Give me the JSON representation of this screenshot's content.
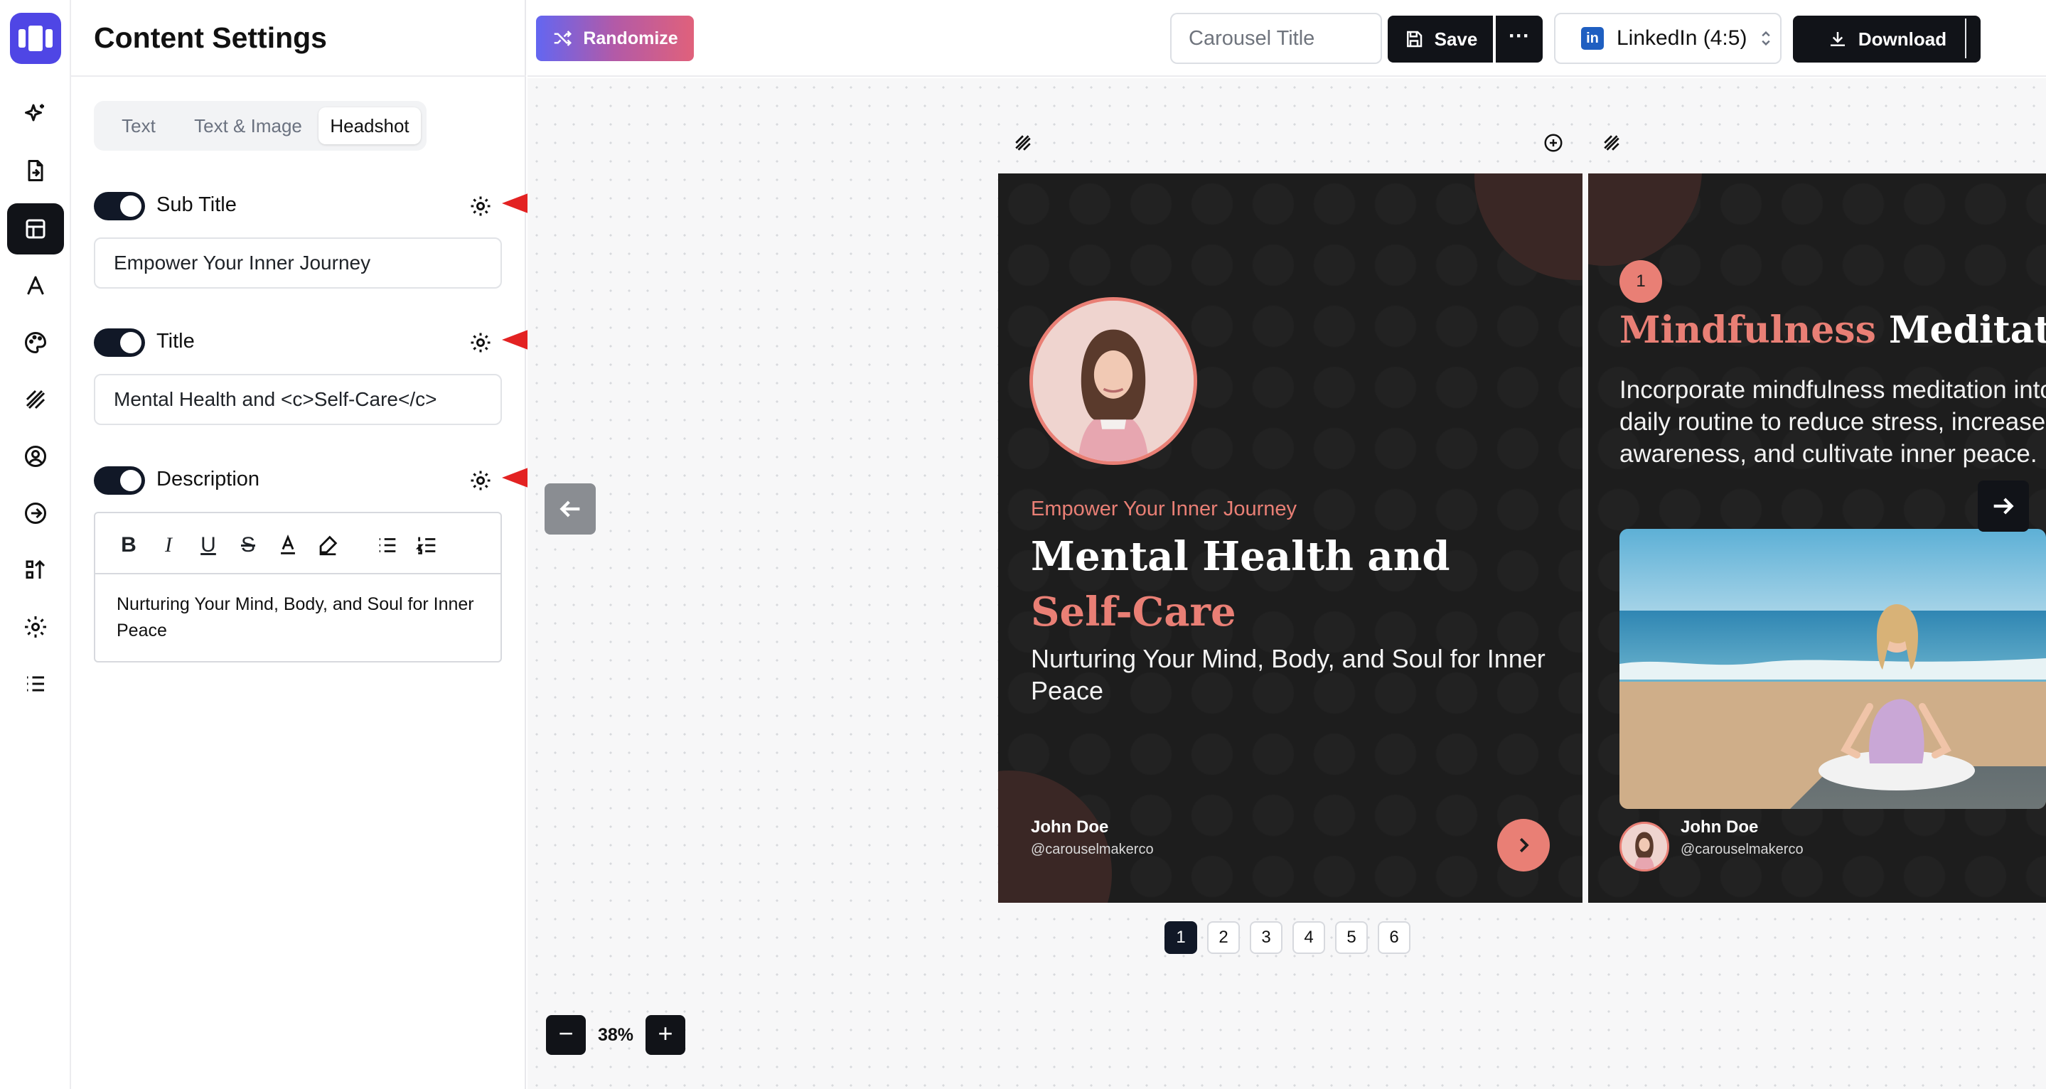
{
  "rail": {
    "items": [
      {
        "icon": "sparkles-icon"
      },
      {
        "icon": "file-import-icon"
      },
      {
        "icon": "layout-icon",
        "active": true
      },
      {
        "icon": "typography-icon"
      },
      {
        "icon": "palette-icon"
      },
      {
        "icon": "pattern-icon"
      },
      {
        "icon": "user-circle-icon"
      },
      {
        "icon": "arrow-circle-right-icon"
      },
      {
        "icon": "sort-icon"
      },
      {
        "icon": "settings-icon"
      },
      {
        "icon": "list-icon"
      }
    ]
  },
  "panel": {
    "title": "Content Settings",
    "tabs": [
      {
        "label": "Text"
      },
      {
        "label": "Text & Image"
      },
      {
        "label": "Headshot",
        "active": true
      }
    ],
    "subtitle_field": {
      "label": "Sub Title",
      "enabled": true,
      "value": "Empower Your Inner Journey"
    },
    "title_field": {
      "label": "Title",
      "enabled": true,
      "value": "Mental Health and <c>Self-Care</c>"
    },
    "description_field": {
      "label": "Description",
      "enabled": true,
      "toolbar": {
        "bold": "B",
        "italic": "I",
        "underline": "U",
        "strike": "S"
      },
      "value": "Nurturing Your Mind, Body, and Soul for Inner Peace"
    }
  },
  "topbar": {
    "randomize_label": "Randomize",
    "carousel_title_placeholder": "Carousel Title",
    "save_label": "Save",
    "more_label": "···",
    "platform_label": "LinkedIn (4:5)",
    "platform_badge": "in",
    "download_label": "Download"
  },
  "slides": [
    {
      "subtitle": "Empower Your Inner Journey",
      "title_part1": "Mental Health and ",
      "title_highlight": "Self-Care",
      "description": "Nurturing Your Mind, Body, and Soul for Inner Peace",
      "author_name": "John Doe",
      "author_handle": "@carouselmakerco"
    },
    {
      "number": "1",
      "title_highlight": "Mindfulness",
      "title_rest": " Meditation",
      "description_lines": [
        "Incorporate mindfulness meditation into your",
        "daily routine to reduce stress, increase self-",
        "awareness, and cultivate inner peace."
      ],
      "author_name": "John Doe",
      "author_handle": "@carouselmakerco"
    }
  ],
  "pager": {
    "pages": [
      "1",
      "2",
      "3",
      "4",
      "5",
      "6"
    ],
    "current": "1"
  },
  "zoom": {
    "minus": "−",
    "value": "38%",
    "plus": "+"
  },
  "colors": {
    "accent": "#e97f75",
    "slide_bg": "#1d1d1d",
    "brand": "#4f46e5",
    "dark": "#111318"
  }
}
